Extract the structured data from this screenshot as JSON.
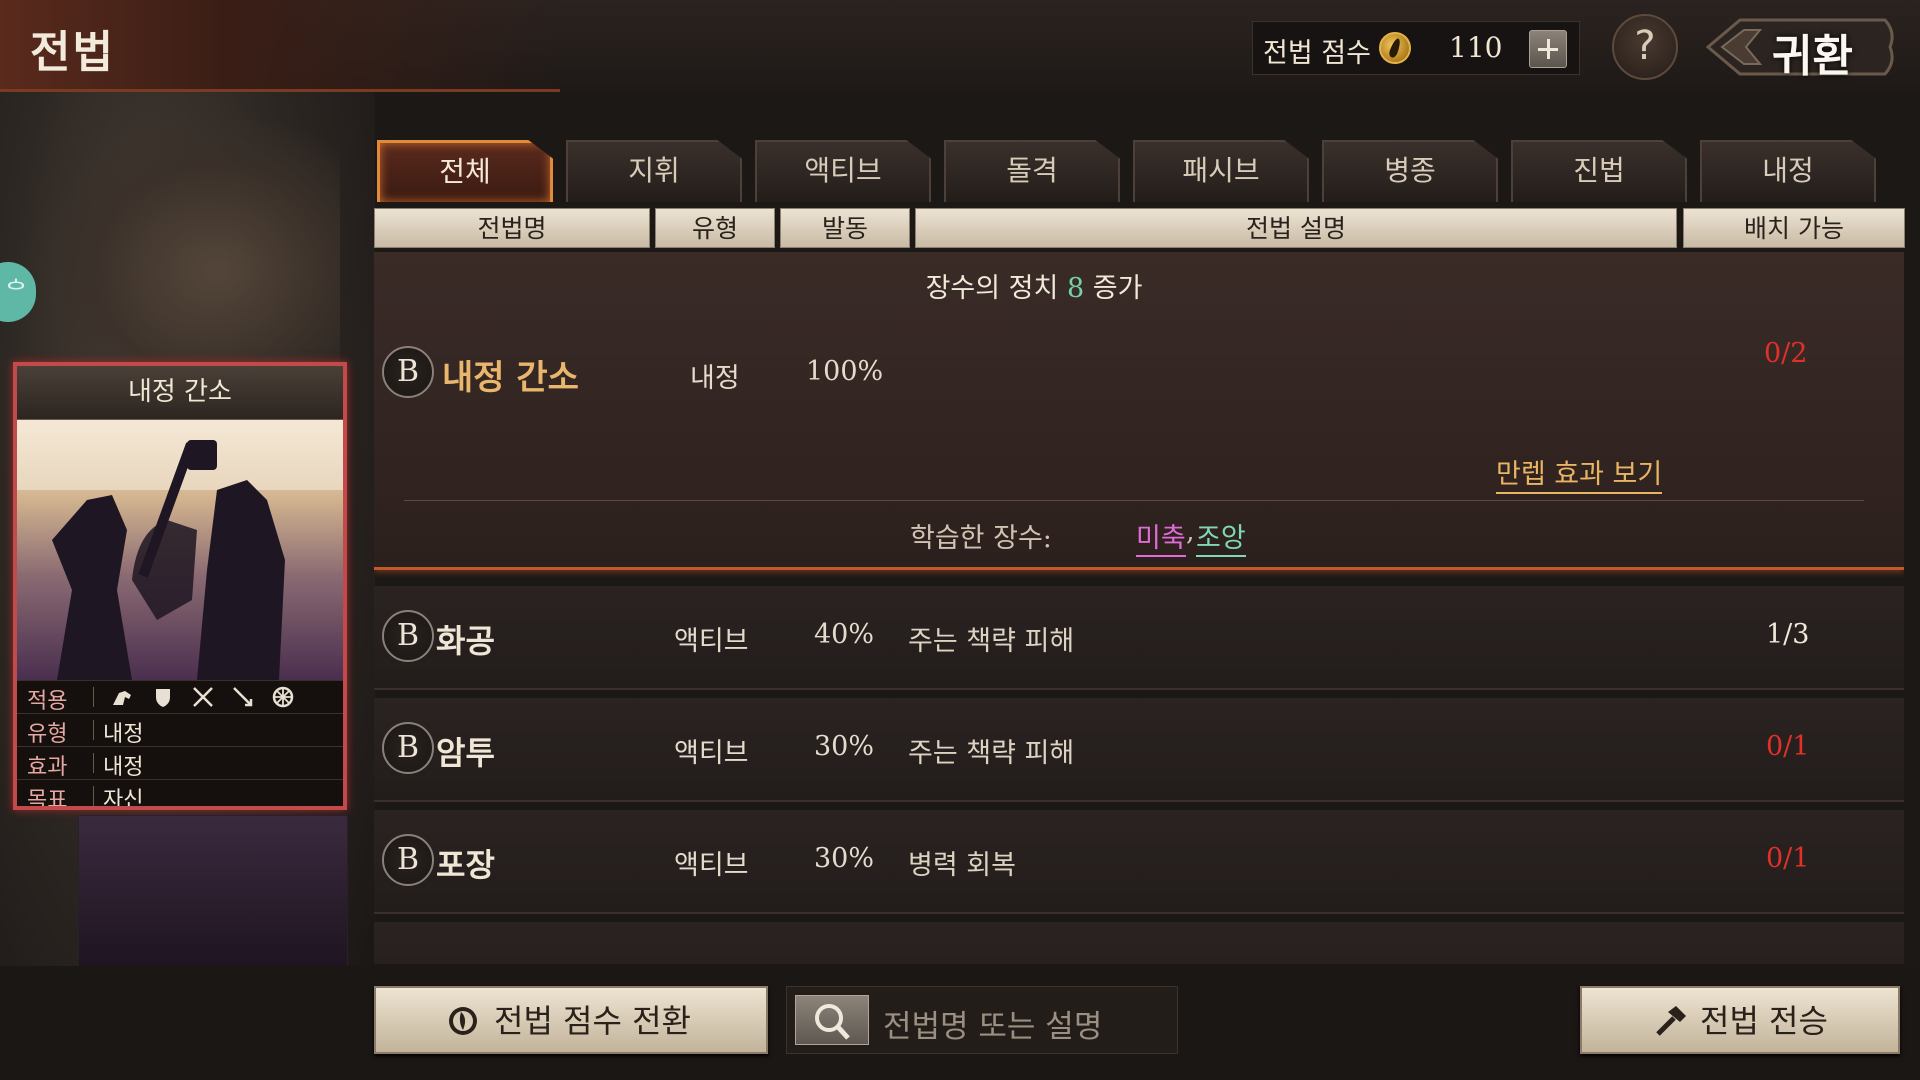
{
  "header": {
    "title": "전법",
    "score_label": "전법 점수",
    "score_value": "110",
    "help_label": "?",
    "back_label": "귀환"
  },
  "tabs": [
    {
      "label": "전체",
      "active": true
    },
    {
      "label": "지휘",
      "active": false
    },
    {
      "label": "액티브",
      "active": false
    },
    {
      "label": "돌격",
      "active": false
    },
    {
      "label": "패시브",
      "active": false
    },
    {
      "label": "병종",
      "active": false
    },
    {
      "label": "진법",
      "active": false
    },
    {
      "label": "내정",
      "active": false
    }
  ],
  "columns": {
    "name": "전법명",
    "type": "유형",
    "trigger": "발동",
    "description": "전법 설명",
    "deployable": "배치 가능"
  },
  "card": {
    "title": "내정 간소",
    "apply_label": "적용",
    "type_label": "유형",
    "type_value": "내정",
    "effect_label": "효과",
    "effect_value": "내정",
    "target_label": "목표",
    "target_value": "자신",
    "unit_icons": [
      "cavalry-icon",
      "shield-icon",
      "crossed-swords-icon",
      "archer-icon",
      "wheel-icon"
    ]
  },
  "expanded": {
    "desc_prefix": "장수의 정치",
    "desc_number": "8",
    "desc_suffix": "증가",
    "grade": "B",
    "name": "내정 간소",
    "type": "내정",
    "rate": "100%",
    "count": "0/2",
    "maxlevel_link": "만렙 효과 보기",
    "learned_label": "학습한 장수:",
    "learned_general_1": "미축",
    "learned_separator": ",",
    "learned_general_2": "조앙"
  },
  "rows": [
    {
      "grade": "B",
      "name": "화공",
      "type": "액티브",
      "rate": "40%",
      "description": "주는 책략 피해",
      "count": "1/3",
      "count_color": "#f0e8da"
    },
    {
      "grade": "B",
      "name": "암투",
      "type": "액티브",
      "rate": "30%",
      "description": "주는 책략 피해",
      "count": "0/1",
      "count_color": "#e0302a"
    },
    {
      "grade": "B",
      "name": "포장",
      "type": "액티브",
      "rate": "30%",
      "description": "병력 회복",
      "count": "0/1",
      "count_color": "#e0302a"
    }
  ],
  "bottom": {
    "convert_label": "전법 점수 전환",
    "search_placeholder": "전법명 또는 설명",
    "inherit_label": "전법 전승"
  },
  "colors": {
    "accent": "#e08a3a",
    "count_red": "#e0302a",
    "highlight_green": "#74d0a8",
    "learned_pink": "#e06ad6",
    "gold": "#e9b464"
  }
}
